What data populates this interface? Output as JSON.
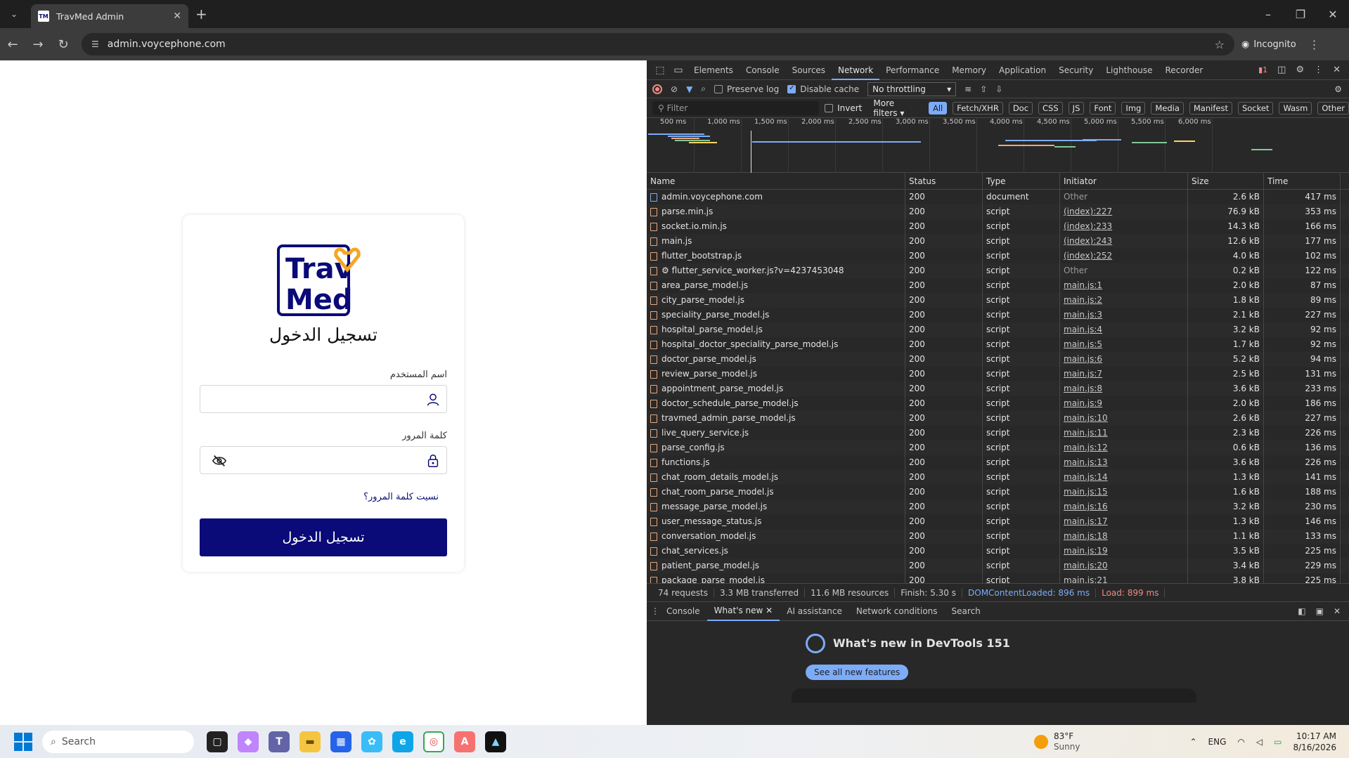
{
  "browser": {
    "tab_title": "TravMed Admin",
    "url": "admin.voycephone.com",
    "incognito_label": "Incognito"
  },
  "login": {
    "logo_line1": "Trav",
    "logo_line2": "Med",
    "title": "تسجيل الدخول",
    "username_label": "اسم المستخدم",
    "password_label": "كلمة المرور",
    "forgot_link": "نسيت كلمة المرور؟",
    "submit": "تسجيل الدخول",
    "brand_color": "#0a0a78"
  },
  "devtools": {
    "tabs": [
      "Elements",
      "Console",
      "Sources",
      "Network",
      "Performance",
      "Memory",
      "Application",
      "Security",
      "Lighthouse",
      "Recorder"
    ],
    "issue_count": "1",
    "toolbar": {
      "preserve_log": "Preserve log",
      "disable_cache": "Disable cache",
      "throttling": "No throttling"
    },
    "filter_placeholder": "Filter",
    "invert": "Invert",
    "more_filters": "More filters",
    "type_filters": [
      "All",
      "Fetch/XHR",
      "Doc",
      "CSS",
      "JS",
      "Font",
      "Img",
      "Media",
      "Manifest",
      "Socket",
      "Wasm",
      "Other"
    ],
    "timeline_ticks": [
      "500 ms",
      "1,000 ms",
      "1,500 ms",
      "2,000 ms",
      "2,500 ms",
      "3,000 ms",
      "3,500 ms",
      "4,000 ms",
      "4,500 ms",
      "5,000 ms",
      "5,500 ms",
      "6,000 ms"
    ],
    "columns": [
      "Name",
      "Status",
      "Type",
      "Initiator",
      "Size",
      "Time"
    ],
    "requests": [
      {
        "name": "admin.voycephone.com",
        "status": "200",
        "type": "document",
        "initiator": "Other",
        "size": "2.6 kB",
        "time": "417 ms"
      },
      {
        "name": "parse.min.js",
        "status": "200",
        "type": "script",
        "initiator": "(index):227",
        "size": "76.9 kB",
        "time": "353 ms"
      },
      {
        "name": "socket.io.min.js",
        "status": "200",
        "type": "script",
        "initiator": "(index):233",
        "size": "14.3 kB",
        "time": "166 ms"
      },
      {
        "name": "main.js",
        "status": "200",
        "type": "script",
        "initiator": "(index):243",
        "size": "12.6 kB",
        "time": "177 ms"
      },
      {
        "name": "flutter_bootstrap.js",
        "status": "200",
        "type": "script",
        "initiator": "(index):252",
        "size": "4.0 kB",
        "time": "102 ms"
      },
      {
        "name": "⚙ flutter_service_worker.js?v=4237453048",
        "status": "200",
        "type": "script",
        "initiator": "Other",
        "size": "0.2 kB",
        "time": "122 ms"
      },
      {
        "name": "area_parse_model.js",
        "status": "200",
        "type": "script",
        "initiator": "main.js:1",
        "size": "2.0 kB",
        "time": "87 ms"
      },
      {
        "name": "city_parse_model.js",
        "status": "200",
        "type": "script",
        "initiator": "main.js:2",
        "size": "1.8 kB",
        "time": "89 ms"
      },
      {
        "name": "speciality_parse_model.js",
        "status": "200",
        "type": "script",
        "initiator": "main.js:3",
        "size": "2.1 kB",
        "time": "227 ms"
      },
      {
        "name": "hospital_parse_model.js",
        "status": "200",
        "type": "script",
        "initiator": "main.js:4",
        "size": "3.2 kB",
        "time": "92 ms"
      },
      {
        "name": "hospital_doctor_speciality_parse_model.js",
        "status": "200",
        "type": "script",
        "initiator": "main.js:5",
        "size": "1.7 kB",
        "time": "92 ms"
      },
      {
        "name": "doctor_parse_model.js",
        "status": "200",
        "type": "script",
        "initiator": "main.js:6",
        "size": "5.2 kB",
        "time": "94 ms"
      },
      {
        "name": "review_parse_model.js",
        "status": "200",
        "type": "script",
        "initiator": "main.js:7",
        "size": "2.5 kB",
        "time": "131 ms"
      },
      {
        "name": "appointment_parse_model.js",
        "status": "200",
        "type": "script",
        "initiator": "main.js:8",
        "size": "3.6 kB",
        "time": "233 ms"
      },
      {
        "name": "doctor_schedule_parse_model.js",
        "status": "200",
        "type": "script",
        "initiator": "main.js:9",
        "size": "2.0 kB",
        "time": "186 ms"
      },
      {
        "name": "travmed_admin_parse_model.js",
        "status": "200",
        "type": "script",
        "initiator": "main.js:10",
        "size": "2.6 kB",
        "time": "227 ms"
      },
      {
        "name": "live_query_service.js",
        "status": "200",
        "type": "script",
        "initiator": "main.js:11",
        "size": "2.3 kB",
        "time": "226 ms"
      },
      {
        "name": "parse_config.js",
        "status": "200",
        "type": "script",
        "initiator": "main.js:12",
        "size": "0.6 kB",
        "time": "136 ms"
      },
      {
        "name": "functions.js",
        "status": "200",
        "type": "script",
        "initiator": "main.js:13",
        "size": "3.6 kB",
        "time": "226 ms"
      },
      {
        "name": "chat_room_details_model.js",
        "status": "200",
        "type": "script",
        "initiator": "main.js:14",
        "size": "1.3 kB",
        "time": "141 ms"
      },
      {
        "name": "chat_room_parse_model.js",
        "status": "200",
        "type": "script",
        "initiator": "main.js:15",
        "size": "1.6 kB",
        "time": "188 ms"
      },
      {
        "name": "message_parse_model.js",
        "status": "200",
        "type": "script",
        "initiator": "main.js:16",
        "size": "3.2 kB",
        "time": "230 ms"
      },
      {
        "name": "user_message_status.js",
        "status": "200",
        "type": "script",
        "initiator": "main.js:17",
        "size": "1.3 kB",
        "time": "146 ms"
      },
      {
        "name": "conversation_model.js",
        "status": "200",
        "type": "script",
        "initiator": "main.js:18",
        "size": "1.1 kB",
        "time": "133 ms"
      },
      {
        "name": "chat_services.js",
        "status": "200",
        "type": "script",
        "initiator": "main.js:19",
        "size": "3.5 kB",
        "time": "225 ms"
      },
      {
        "name": "patient_parse_model.js",
        "status": "200",
        "type": "script",
        "initiator": "main.js:20",
        "size": "3.4 kB",
        "time": "229 ms"
      },
      {
        "name": "package_parse_model.js",
        "status": "200",
        "type": "script",
        "initiator": "main.js:21",
        "size": "3.8 kB",
        "time": "225 ms"
      }
    ],
    "summary": {
      "requests": "74 requests",
      "transferred": "3.3 MB transferred",
      "resources": "11.6 MB resources",
      "finish": "Finish: 5.30 s",
      "dcl": "DOMContentLoaded: 896 ms",
      "load": "Load: 899 ms"
    },
    "drawer_tabs": [
      "Console",
      "What's new",
      "AI assistance",
      "Network conditions",
      "Search"
    ],
    "whats_new_title": "What's new in DevTools 151",
    "whats_new_button": "See all new features"
  },
  "taskbar": {
    "search_placeholder": "Search",
    "temperature": "83°F",
    "condition": "Sunny",
    "language": "ENG",
    "time": "10:17 AM",
    "date": "8/16/2026"
  }
}
